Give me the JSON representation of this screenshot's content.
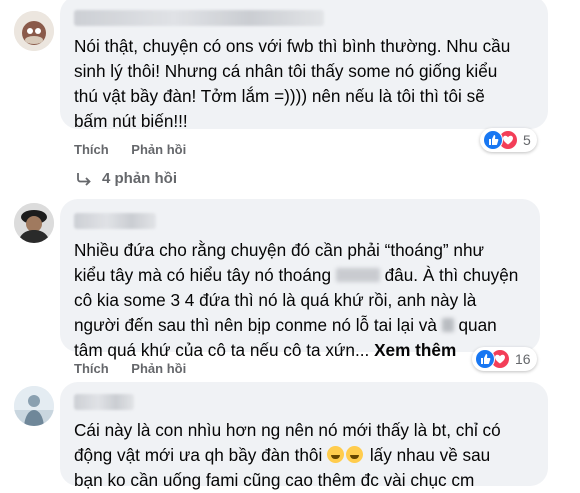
{
  "comments": [
    {
      "text": "Nói thật, chuyện có ons với fwb thì bình thường. Nhu cầu\nsinh lý thôi! Nhưng cá nhân tôi thấy some nó giống kiểu\nthú vật bầy đàn! Tởm lắm =)))) nên nếu là tôi thì tôi sẽ\nbấm nút biến!!!",
      "reaction_count": "5",
      "like_label": "Thích",
      "reply_label": "Phản hồi",
      "replies_label": "4 phản hồi"
    },
    {
      "text_part1": "Nhiều đứa cho rằng chuyện đó cần phải “thoáng” như\nkiểu tây mà có hiểu tây nó thoáng ",
      "text_part2": " đâu. À thì chuyện\ncô kia some 3 4 đứa thì nó là quá khứ rồi, anh này là\nngười đến sau thì nên bịp conme nó lỗ tai lại và ",
      "text_part3": " quan\ntâm quá khứ của cô ta nếu cô ta xứn... ",
      "see_more": "Xem thêm",
      "reaction_count": "16",
      "like_label": "Thích",
      "reply_label": "Phản hồi"
    },
    {
      "text_part1": "Cái này là con nhìu hơn ng nên nó mới thấy là bt, chỉ có\nđộng vật mới ưa qh bầy đàn thôi ",
      "text_part2": " lấy nhau về sau\nbạn ko cần uống fami cũng cao thêm đc vài chục cm"
    }
  ],
  "colors": {
    "bubble": "#f0f2f5",
    "like_blue": "#1877f2",
    "love_red": "#f33e58",
    "secondary_text": "#65676b"
  }
}
